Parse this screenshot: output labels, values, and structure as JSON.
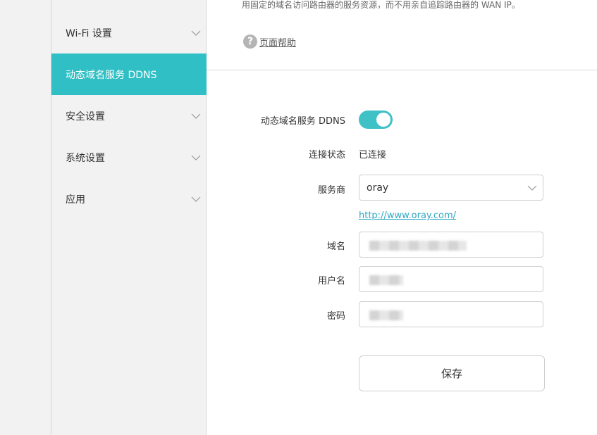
{
  "sidebar": {
    "items": [
      {
        "label": "Wi-Fi 设置",
        "has_chevron": true
      },
      {
        "label": "动态域名服务 DDNS",
        "active": true
      },
      {
        "label": "安全设置",
        "has_chevron": true
      },
      {
        "label": "系统设置",
        "has_chevron": true
      },
      {
        "label": "应用",
        "has_chevron": true
      }
    ]
  },
  "main": {
    "description": "用固定的域名访问路由器的服务资源，而不用亲自追踪路由器的 WAN IP。",
    "help_link": "页面帮助",
    "form": {
      "ddns_label": "动态域名服务 DDNS",
      "ddns_enabled": true,
      "status_label": "连接状态",
      "status_value": "已连接",
      "provider_label": "服务商",
      "provider_value": "oray",
      "provider_url": "http://www.oray.com/",
      "domain_label": "域名",
      "username_label": "用户名",
      "password_label": "密码",
      "save_label": "保存"
    }
  },
  "colors": {
    "accent": "#2fbfc4",
    "toggle_on": "#3fc1c6",
    "link": "#2fa8c4"
  },
  "icons": {
    "help": "question-circle-icon",
    "chevron": "chevron-down-icon"
  }
}
